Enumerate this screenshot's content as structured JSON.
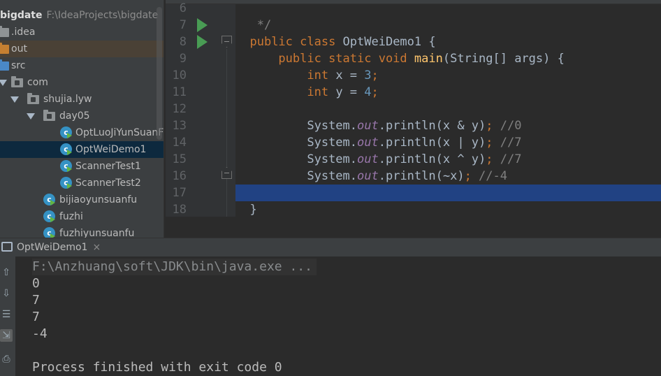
{
  "project_tree": {
    "root": {
      "name": "bigdate",
      "path": "F:\\IdeaProjects\\bigdate"
    },
    "items": [
      {
        "label": ".idea"
      },
      {
        "label": "out"
      },
      {
        "label": "src"
      },
      {
        "label": "com"
      },
      {
        "label": "shujia.lyw"
      },
      {
        "label": "day05"
      },
      {
        "label": "OptLuoJiYunSuanF"
      },
      {
        "label": "OptWeiDemo1"
      },
      {
        "label": "ScannerTest1"
      },
      {
        "label": "ScannerTest2"
      },
      {
        "label": "bijiaoyunsuanfu"
      },
      {
        "label": "fuzhi"
      },
      {
        "label": "fuzhiyunsuanfu"
      }
    ]
  },
  "editor": {
    "line_numbers": [
      "6",
      "7",
      "8",
      "9",
      "10",
      "11",
      "12",
      "13",
      "14",
      "15",
      "16",
      "17",
      "18"
    ],
    "code": {
      "l6": " */",
      "l7_kw": "public class ",
      "l7_name": "OptWeiDemo1 ",
      "l7_brace": "{",
      "l8_kw": "    public static void ",
      "l8_fn": "main",
      "l8_rest": "(String[] args) ",
      "l8_brace": "{",
      "l9_kw": "        int ",
      "l9_rest": "x = ",
      "l9_num": "3",
      "l9_semi": ";",
      "l10_kw": "        int ",
      "l10_rest": "y = ",
      "l10_num": "4",
      "l10_semi": ";",
      "l12_sys": "        System.",
      "l12_out": "out",
      "l12_mid": ".println(x & y)",
      "l12_semi": ";",
      "l12_cmt": " //0",
      "l13_sys": "        System.",
      "l13_out": "out",
      "l13_mid": ".println(x | y)",
      "l13_semi": ";",
      "l13_cmt": " //7",
      "l14_sys": "        System.",
      "l14_out": "out",
      "l14_mid": ".println(x ^ y)",
      "l14_semi": ";",
      "l14_cmt": " //7",
      "l15_sys": "        System.",
      "l15_out": "out",
      "l15_mid": ".println(~x)",
      "l15_semi": ";",
      "l15_cmt": " //-4",
      "l16": "    }",
      "l17": "}"
    }
  },
  "run_panel": {
    "tab_label": "OptWeiDemo1",
    "tab_close": "×",
    "console": {
      "command": "F:\\Anzhuang\\soft\\JDK\\bin\\java.exe ...",
      "outputs": [
        "0",
        "7",
        "7",
        "-4"
      ],
      "exit_message": "Process finished with exit code 0"
    },
    "toolbar_icons": [
      "arrow-up-icon",
      "arrow-down-icon",
      "soft-wrap-icon",
      "scroll-to-end-icon",
      "print-icon"
    ]
  },
  "colors": {
    "keyword": "#cc7832",
    "number": "#6897bb",
    "comment": "#808080",
    "static_field": "#9876aa",
    "method": "#ffc66d",
    "selection": "#214283"
  }
}
